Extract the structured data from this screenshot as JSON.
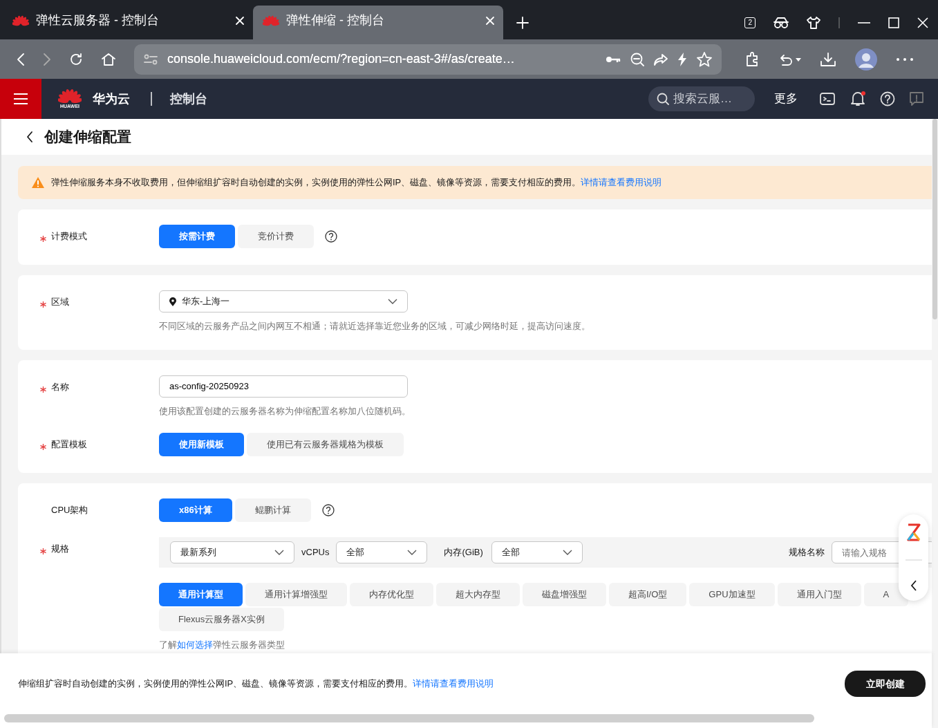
{
  "browser": {
    "tabs": [
      {
        "title": "弹性云服务器 - 控制台",
        "selected": false
      },
      {
        "title": "弹性伸缩 - 控制台",
        "selected": true
      }
    ],
    "tab_count": "2",
    "url": "console.huaweicloud.com/ecm/?region=cn-east-3#/as/create…"
  },
  "console_header": {
    "logo_text": "HUAWEI",
    "brand": "华为云",
    "section": "控制台",
    "search": {
      "placeholder": "搜索云服…"
    },
    "more": "更多",
    "notification_dot": true
  },
  "page": {
    "title": "创建伸缩配置",
    "notice": {
      "text": "弹性伸缩服务本身不收取费用，但伸缩组扩容时自动创建的实例，实例使用的弹性公网IP、磁盘、镜像等资源，需要支付相应的费用。",
      "link": "详情请查看费用说明"
    },
    "sections": [
      {
        "rows": [
          {
            "kind": "toggle",
            "label": "计费模式",
            "required": true,
            "help": true,
            "options": [
              {
                "label": "按需计费",
                "selected": true
              },
              {
                "label": "竞价计费",
                "selected": false
              }
            ]
          }
        ]
      },
      {
        "rows": [
          {
            "kind": "select",
            "label": "区域",
            "required": true,
            "value": "华东-上海一",
            "hint": "不同区域的云服务产品之间内网互不相通；请就近选择靠近您业务的区域，可减少网络时延，提高访问速度。"
          }
        ]
      },
      {
        "rows": [
          {
            "kind": "input",
            "label": "名称",
            "required": true,
            "value": "as-config-20250923",
            "hint": "使用该配置创建的云服务器名称为伸缩配置名称加八位随机码。"
          },
          {
            "kind": "toggle",
            "label": "配置模板",
            "required": true,
            "help": false,
            "options": [
              {
                "label": "使用新模板",
                "selected": true
              },
              {
                "label": "使用已有云服务器规格为模板",
                "selected": false
              }
            ]
          }
        ]
      },
      {
        "rows": [
          {
            "kind": "toggle",
            "label": "CPU架构",
            "required": false,
            "help": true,
            "options": [
              {
                "label": "x86计算",
                "selected": true
              },
              {
                "label": "鲲鹏计算",
                "selected": false
              }
            ]
          },
          {
            "kind": "spec",
            "label": "规格",
            "required": true,
            "filters": [
              {
                "kind": "select",
                "value": "最新系列"
              },
              {
                "kind": "label",
                "text": "vCPUs"
              },
              {
                "kind": "select",
                "value": "全部"
              },
              {
                "kind": "label",
                "text": "内存(GiB)"
              },
              {
                "kind": "select",
                "value": "全部"
              }
            ],
            "name_filter": {
              "label": "规格名称",
              "placeholder": "请输入规格"
            },
            "category_rows": [
              [
                {
                  "label": "通用计算型",
                  "selected": true
                },
                {
                  "label": "通用计算增强型",
                  "selected": false
                },
                {
                  "label": "内存优化型",
                  "selected": false
                },
                {
                  "label": "超大内存型",
                  "selected": false
                },
                {
                  "label": "磁盘增强型",
                  "selected": false
                },
                {
                  "label": "超高I/O型",
                  "selected": false
                },
                {
                  "label": "GPU加速型",
                  "selected": false
                },
                {
                  "label": "通用入门型",
                  "selected": false
                },
                {
                  "label": "A",
                  "selected": false
                }
              ],
              [
                {
                  "label": "Flexus云服务器X实例",
                  "selected": false
                }
              ]
            ],
            "learn": {
              "before": "了解",
              "link": "如何选择",
              "after": "弹性云服务器类型"
            }
          }
        ]
      }
    ]
  },
  "footer": {
    "text": "伸缩组扩容时自动创建的实例，实例使用的弹性公网IP、磁盘、镜像等资源，需要支付相应的费用。",
    "link": "详情请查看费用说明",
    "button": "立即创建"
  }
}
